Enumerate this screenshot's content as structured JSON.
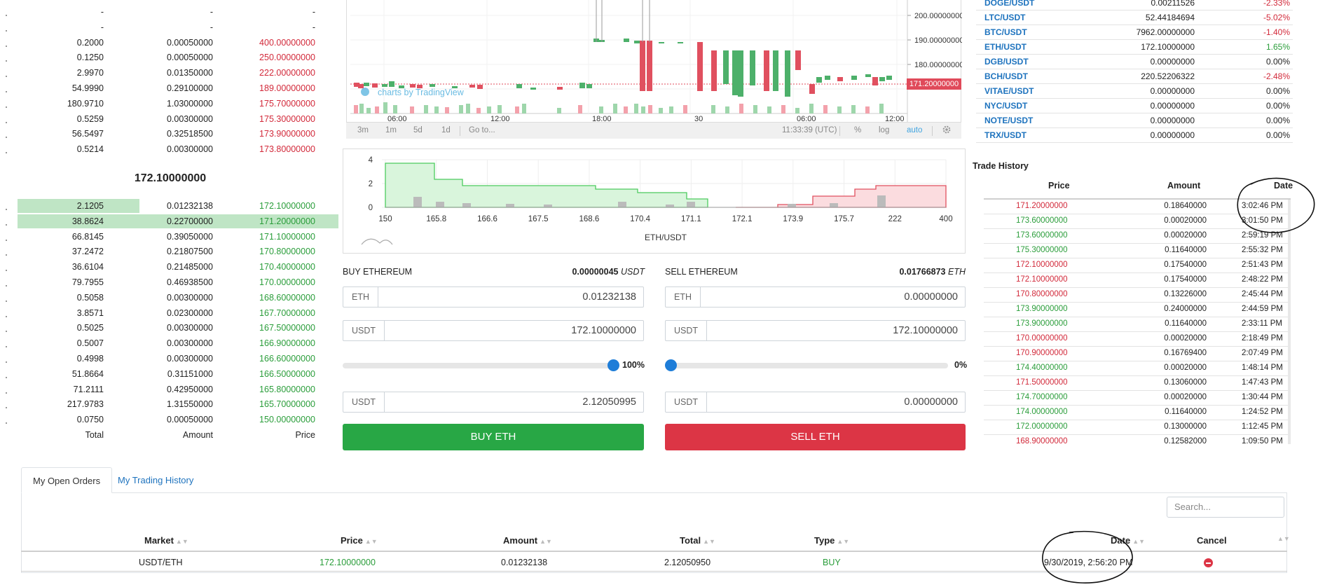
{
  "orderbook": {
    "asks": [
      {
        "total": "-",
        "amount": "-",
        "price": "-"
      },
      {
        "total": "-",
        "amount": "-",
        "price": "-"
      },
      {
        "total": "0.2000",
        "amount": "0.00050000",
        "price": "400.00000000"
      },
      {
        "total": "0.1250",
        "amount": "0.00050000",
        "price": "250.00000000"
      },
      {
        "total": "2.9970",
        "amount": "0.01350000",
        "price": "222.00000000"
      },
      {
        "total": "54.9990",
        "amount": "0.29100000",
        "price": "189.00000000"
      },
      {
        "total": "180.9710",
        "amount": "1.03000000",
        "price": "175.70000000"
      },
      {
        "total": "0.5259",
        "amount": "0.00300000",
        "price": "175.30000000"
      },
      {
        "total": "56.5497",
        "amount": "0.32518500",
        "price": "173.90000000"
      },
      {
        "total": "0.5214",
        "amount": "0.00300000",
        "price": "173.80000000"
      }
    ],
    "last_price": "172.10000000",
    "bids": [
      {
        "total": "2.1205",
        "amount": "0.01232138",
        "price": "172.10000000",
        "fill": 0.38
      },
      {
        "total": "38.8624",
        "amount": "0.22700000",
        "price": "171.20000000",
        "fill": 1.0
      },
      {
        "total": "66.8145",
        "amount": "0.39050000",
        "price": "171.10000000"
      },
      {
        "total": "37.2472",
        "amount": "0.21807500",
        "price": "170.80000000"
      },
      {
        "total": "36.6104",
        "amount": "0.21485000",
        "price": "170.40000000"
      },
      {
        "total": "79.7955",
        "amount": "0.46938500",
        "price": "170.00000000"
      },
      {
        "total": "0.5058",
        "amount": "0.00300000",
        "price": "168.60000000"
      },
      {
        "total": "3.8571",
        "amount": "0.02300000",
        "price": "167.70000000"
      },
      {
        "total": "0.5025",
        "amount": "0.00300000",
        "price": "167.50000000"
      },
      {
        "total": "0.5007",
        "amount": "0.00300000",
        "price": "166.90000000"
      },
      {
        "total": "0.4998",
        "amount": "0.00300000",
        "price": "166.60000000"
      },
      {
        "total": "51.8664",
        "amount": "0.31151000",
        "price": "166.50000000"
      },
      {
        "total": "71.2111",
        "amount": "0.42950000",
        "price": "165.80000000"
      },
      {
        "total": "217.9783",
        "amount": "1.31550000",
        "price": "165.70000000"
      },
      {
        "total": "0.0750",
        "amount": "0.00050000",
        "price": "150.00000000"
      }
    ],
    "headers": {
      "total": "Total",
      "amount": "Amount",
      "price": "Price"
    }
  },
  "candle_chart": {
    "y_ticks": [
      "200.00000000",
      "190.00000000",
      "180.00000000"
    ],
    "x_ticks": [
      "06:00",
      "12:00",
      "18:00",
      "30",
      "06:00",
      "12:00"
    ],
    "current_price": "171.20000000",
    "watermark": "charts by TradingView",
    "toolbar": {
      "ranges": [
        "3m",
        "1m",
        "5d",
        "1d"
      ],
      "goto": "Go to...",
      "time": "11:33:39 (UTC)",
      "percent": "%",
      "log": "log",
      "auto": "auto"
    }
  },
  "depth_chart": {
    "y_ticks": [
      "4",
      "2",
      "0"
    ],
    "x_ticks": [
      "150",
      "165.8",
      "166.6",
      "167.5",
      "168.6",
      "170.4",
      "171.1",
      "172.1",
      "173.9",
      "175.7",
      "222",
      "400"
    ],
    "xlabel": "ETH/USDT"
  },
  "buy_form": {
    "title": "BUY ETHEREUM",
    "balance": "0.00000045",
    "balance_unit": "USDT",
    "amount_label": "ETH",
    "amount_value": "0.01232138",
    "price_label": "USDT",
    "price_value": "172.10000000",
    "slider_pct": "100%",
    "slider_level": 1.0,
    "total_label": "USDT",
    "total_value": "2.12050995",
    "button": "BUY ETH"
  },
  "sell_form": {
    "title": "SELL ETHEREUM",
    "balance": "0.01766873",
    "balance_unit": "ETH",
    "amount_label": "ETH",
    "amount_value": "0.00000000",
    "price_label": "USDT",
    "price_value": "172.10000000",
    "slider_pct": "0%",
    "slider_level": 0.0,
    "total_label": "USDT",
    "total_value": "0.00000000",
    "button": "SELL ETH"
  },
  "markets": [
    {
      "pair": "DOGE/USDT",
      "price": "0.00211526",
      "change": "-2.33%",
      "dir": "neg"
    },
    {
      "pair": "LTC/USDT",
      "price": "52.44184694",
      "change": "-5.02%",
      "dir": "neg"
    },
    {
      "pair": "BTC/USDT",
      "price": "7962.00000000",
      "change": "-1.40%",
      "dir": "neg"
    },
    {
      "pair": "ETH/USDT",
      "price": "172.10000000",
      "change": "1.65%",
      "dir": "pos"
    },
    {
      "pair": "DGB/USDT",
      "price": "0.00000000",
      "change": "0.00%",
      "dir": "zero"
    },
    {
      "pair": "BCH/USDT",
      "price": "220.52206322",
      "change": "-2.48%",
      "dir": "neg"
    },
    {
      "pair": "VITAE/USDT",
      "price": "0.00000000",
      "change": "0.00%",
      "dir": "zero"
    },
    {
      "pair": "NYC/USDT",
      "price": "0.00000000",
      "change": "0.00%",
      "dir": "zero"
    },
    {
      "pair": "NOTE/USDT",
      "price": "0.00000000",
      "change": "0.00%",
      "dir": "zero"
    },
    {
      "pair": "TRX/USDT",
      "price": "0.00000000",
      "change": "0.00%",
      "dir": "zero"
    }
  ],
  "trade_history": {
    "title": "Trade History",
    "headers": {
      "price": "Price",
      "amount": "Amount",
      "date": "Date"
    },
    "rows": [
      {
        "price": "171.20000000",
        "amount": "0.18640000",
        "date": "3:02:46 PM",
        "side": "sell"
      },
      {
        "price": "173.60000000",
        "amount": "0.00020000",
        "date": "3:01:50 PM",
        "side": "buy"
      },
      {
        "price": "173.60000000",
        "amount": "0.00020000",
        "date": "2:59:19 PM",
        "side": "buy"
      },
      {
        "price": "175.30000000",
        "amount": "0.11640000",
        "date": "2:55:32 PM",
        "side": "buy"
      },
      {
        "price": "172.10000000",
        "amount": "0.17540000",
        "date": "2:51:43 PM",
        "side": "sell"
      },
      {
        "price": "172.10000000",
        "amount": "0.17540000",
        "date": "2:48:22 PM",
        "side": "sell"
      },
      {
        "price": "170.80000000",
        "amount": "0.13226000",
        "date": "2:45:44 PM",
        "side": "sell"
      },
      {
        "price": "173.90000000",
        "amount": "0.24000000",
        "date": "2:44:59 PM",
        "side": "buy"
      },
      {
        "price": "173.90000000",
        "amount": "0.11640000",
        "date": "2:33:11 PM",
        "side": "buy"
      },
      {
        "price": "170.00000000",
        "amount": "0.00020000",
        "date": "2:18:49 PM",
        "side": "sell"
      },
      {
        "price": "170.90000000",
        "amount": "0.16769400",
        "date": "2:07:49 PM",
        "side": "sell"
      },
      {
        "price": "174.40000000",
        "amount": "0.00020000",
        "date": "1:48:14 PM",
        "side": "buy"
      },
      {
        "price": "171.50000000",
        "amount": "0.13060000",
        "date": "1:47:43 PM",
        "side": "sell"
      },
      {
        "price": "174.70000000",
        "amount": "0.00020000",
        "date": "1:30:44 PM",
        "side": "buy"
      },
      {
        "price": "174.00000000",
        "amount": "0.11640000",
        "date": "1:24:52 PM",
        "side": "buy"
      },
      {
        "price": "172.00000000",
        "amount": "0.13000000",
        "date": "1:12:45 PM",
        "side": "buy"
      },
      {
        "price": "168.90000000",
        "amount": "0.12582000",
        "date": "1:09:50 PM",
        "side": "sell"
      }
    ]
  },
  "orders": {
    "tabs": [
      "My Open Orders",
      "My Trading History"
    ],
    "search_placeholder": "Search...",
    "headers": [
      "Market",
      "Price",
      "Amount",
      "Total",
      "Type",
      "Date",
      "Cancel"
    ],
    "row": {
      "market": "USDT/ETH",
      "price": "172.10000000",
      "amount": "0.01232138",
      "total": "2.12050950",
      "type": "BUY",
      "date": "9/30/2019, 2:56:20 PM"
    }
  },
  "colors": {
    "buy": "#2a9d3a",
    "sell": "#d2293a",
    "link": "#1e73be",
    "accent": "#1e7dd8"
  }
}
